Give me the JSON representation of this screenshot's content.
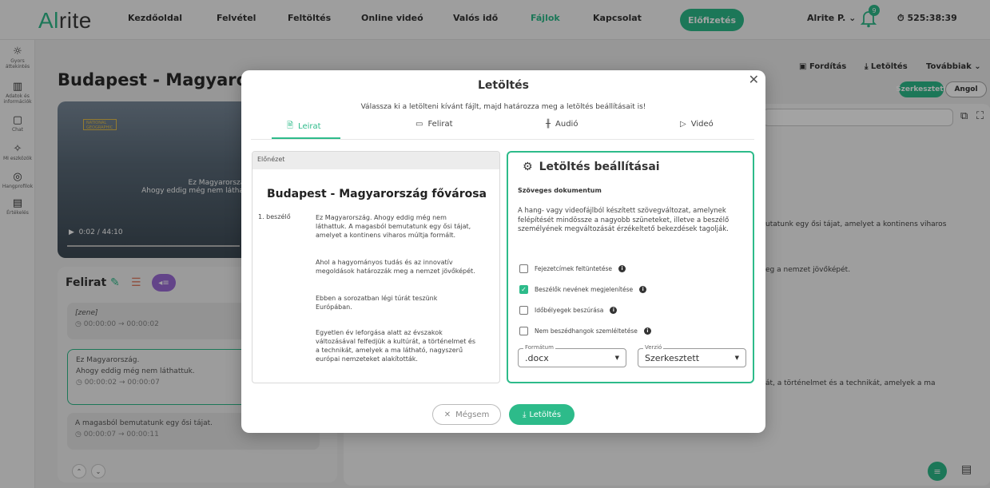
{
  "app": {
    "logo_prefix": "Al",
    "logo_suffix": "rite"
  },
  "nav": {
    "items": [
      "Kezdőoldal",
      "Felvétel",
      "Feltöltés",
      "Online videó",
      "Valós idő",
      "Fájlok",
      "Kapcsolat"
    ],
    "subscribe": "Előfizetés",
    "user": "Alrite P.",
    "notifications": "9",
    "timer": "525:38:39"
  },
  "sidebar": {
    "items": [
      {
        "label": "Gyors áttekintés",
        "icon": "lightbulb-icon"
      },
      {
        "label": "Adatok és információk",
        "icon": "chart-icon"
      },
      {
        "label": "Chat",
        "icon": "chat-icon"
      },
      {
        "label": "MI eszközök",
        "icon": "sparkle-icon"
      },
      {
        "label": "Hangprofilok",
        "icon": "voice-icon"
      },
      {
        "label": "Értékelés",
        "icon": "rating-icon"
      }
    ]
  },
  "page": {
    "title": "Budapest - Magyarország",
    "video": {
      "badge": "NATIONAL GEOGRAPHIC",
      "caption1": "Ez Magyarország",
      "caption2": "Ahogy eddig még nem láthatt",
      "time": "0:02 / 44:10"
    },
    "subtitles_title": "Felirat",
    "subtitle_cards": [
      {
        "text": "[zene]",
        "time": "00:00:00 → 00:00:02"
      },
      {
        "text": "Ez Magyarország.\nAhogy eddig még nem láthattuk.",
        "time": "00:00:02 → 00:00:07"
      },
      {
        "text": "A magasból bemutatunk egy ősi tájat.",
        "time": "00:00:07 → 00:00:11"
      }
    ],
    "toolbar": {
      "translate": "Fordítás",
      "download": "Letöltés",
      "more": "Továbbiak"
    },
    "edited": "Szerkesztett",
    "language": "Angol",
    "bg_texts": [
      "utatunk egy ősi tájat, amelyet a kontinens viharos",
      "eg a nemzet jövőképét.",
      "át, a történelmet és a technikát, amelyek a ma"
    ]
  },
  "modal": {
    "title": "Letöltés",
    "subtitle": "Válassza ki a letölteni kívánt fájlt, majd határozza meg a letöltés beállításait is!",
    "tabs": [
      "Leirat",
      "Felirat",
      "Audió",
      "Videó"
    ],
    "preview": {
      "header": "Előnézet",
      "title": "Budapest - Magyarország fővárosa",
      "speaker": "1. beszélő",
      "paragraphs": [
        "Ez Magyarország. Ahogy eddig még nem láthattuk. A magasból bemutatunk egy ősi tájat, amelyet a kontinens viharos múltja formált.",
        "Ahol a hagyományos tudás és az innovatív megoldások határozzák meg a nemzet jövőképét.",
        "Ebben a sorozatban légi túrát teszünk Európában.",
        "Egyetlen év leforgása alatt az évszakok változásával felfedjük a kultúrát, a történelmet és a technikát, amelyek a ma látható, nagyszerű európai nemzeteket alakították."
      ]
    },
    "settings": {
      "title": "Letöltés beállításai",
      "subtitle": "Szöveges dokumentum",
      "description": "A hang- vagy videofájlból készített szövegváltozat, amelynek felépítését mindössze a nagyobb szüneteket, illetve a beszélő személyének megváltozását érzékeltető bekezdések tagolják.",
      "options": [
        {
          "label": "Fejezetcímek feltüntetése",
          "checked": false
        },
        {
          "label": "Beszélők nevének megjelenítése",
          "checked": true
        },
        {
          "label": "Időbélyegek beszúrása",
          "checked": false
        },
        {
          "label": "Nem beszédhangok szemléltetése",
          "checked": false
        }
      ],
      "format_label": "Formátum",
      "format_value": ".docx",
      "version_label": "Verzió",
      "version_value": "Szerkesztett"
    },
    "cancel": "Mégsem",
    "download": "Letöltés"
  },
  "colors": {
    "accent": "#2dbb8a"
  }
}
